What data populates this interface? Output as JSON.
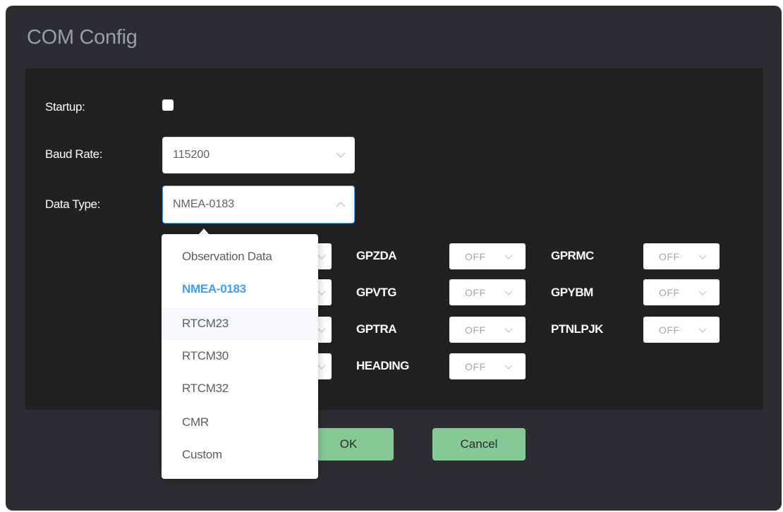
{
  "dialog": {
    "title": "COM Config"
  },
  "form": {
    "startup_label": "Startup:",
    "startup_checked": false,
    "baud_label": "Baud Rate:",
    "baud_value": "115200",
    "datatype_label": "Data Type:",
    "datatype_value": "NMEA-0183"
  },
  "messages": [
    {
      "name": "GPZDA",
      "value": "OFF"
    },
    {
      "name": "GPRMC",
      "value": "OFF"
    },
    {
      "name": "GPVTG",
      "value": "OFF"
    },
    {
      "name": "GPYBM",
      "value": "OFF"
    },
    {
      "name": "GPTRA",
      "value": "OFF"
    },
    {
      "name": "PTNLPJK",
      "value": "OFF"
    },
    {
      "name": "HEADING",
      "value": "OFF"
    }
  ],
  "buttons": {
    "ok": "OK",
    "cancel": "Cancel"
  },
  "dropdown": {
    "options": [
      "Observation Data",
      "NMEA-0183",
      "RTCM23",
      "RTCM30",
      "RTCM32",
      "CMR",
      "Custom"
    ],
    "selected": "NMEA-0183",
    "hovered": "RTCM23"
  },
  "colors": {
    "dialog_bg": "#2c2d30",
    "panel_bg": "#212122",
    "button_bg": "#85c997",
    "accent": "#409eff"
  }
}
